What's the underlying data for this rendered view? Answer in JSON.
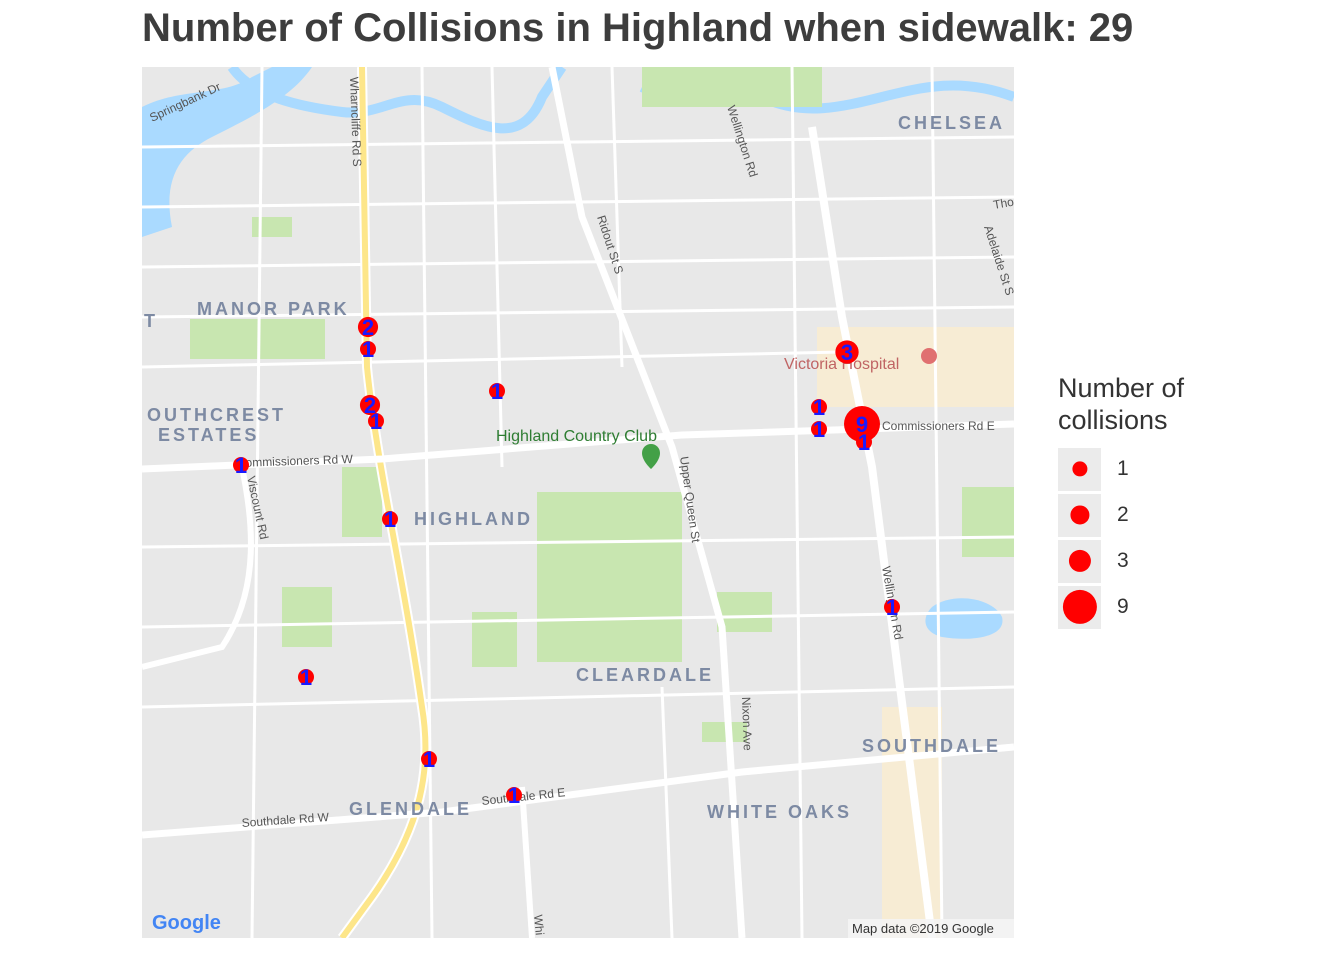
{
  "title": "Number of Collisions in Highland when sidewalk: 29",
  "legend": {
    "title_line1": "Number of",
    "title_line2": "collisions",
    "keys": [
      {
        "label": "1",
        "value": 1
      },
      {
        "label": "2",
        "value": 2
      },
      {
        "label": "3",
        "value": 3
      },
      {
        "label": "9",
        "value": 9
      }
    ]
  },
  "map": {
    "google_logo": "Google",
    "attribution": "Map data ©2019 Google",
    "neighbourhoods": [
      "CHELSEA",
      "MANOR PARK",
      "OUTHCREST",
      "ESTATES",
      "HIGHLAND",
      "CLEARDALE",
      "SOUTHDALE",
      "GLENDALE",
      "WHITE OAKS",
      "T"
    ],
    "roads": [
      "Springbank Dr",
      "Wharncliffe Rd S",
      "Ridout St S",
      "Wellington Rd",
      "Adelaide St S",
      "Commissioners Rd W",
      "Commissioners Rd E",
      "Viscount Rd",
      "Upper Queen St",
      "Nixon Ave",
      "Southdale Rd W",
      "Southdale Rd E",
      "Wellington Rd",
      "Thompson Rd",
      "Whi"
    ],
    "places": [
      "Victoria Hospital",
      "Highland Country Club"
    ]
  },
  "colors": {
    "point_fill": "#ff0000",
    "label_text": "#1a1aff",
    "water": "#aadaff",
    "park": "#c8e6b0",
    "major_road": "#fde68a",
    "background": "#e8e8e8"
  },
  "collisions": [
    {
      "count": 2,
      "lon": 226,
      "lat": 260
    },
    {
      "count": 1,
      "lon": 226,
      "lat": 282
    },
    {
      "count": 2,
      "lon": 228,
      "lat": 338
    },
    {
      "count": 1,
      "lon": 234,
      "lat": 354
    },
    {
      "count": 1,
      "lon": 355,
      "lat": 324
    },
    {
      "count": 1,
      "lon": 99,
      "lat": 398
    },
    {
      "count": 1,
      "lon": 248,
      "lat": 452
    },
    {
      "count": 1,
      "lon": 164,
      "lat": 610
    },
    {
      "count": 1,
      "lon": 287,
      "lat": 692
    },
    {
      "count": 1,
      "lon": 372,
      "lat": 728
    },
    {
      "count": 3,
      "lon": 705,
      "lat": 285
    },
    {
      "count": 1,
      "lon": 677,
      "lat": 340
    },
    {
      "count": 1,
      "lon": 677,
      "lat": 362
    },
    {
      "count": 9,
      "lon": 720,
      "lat": 357
    },
    {
      "count": 1,
      "lon": 722,
      "lat": 375
    },
    {
      "count": 1,
      "lon": 750,
      "lat": 540
    }
  ]
}
